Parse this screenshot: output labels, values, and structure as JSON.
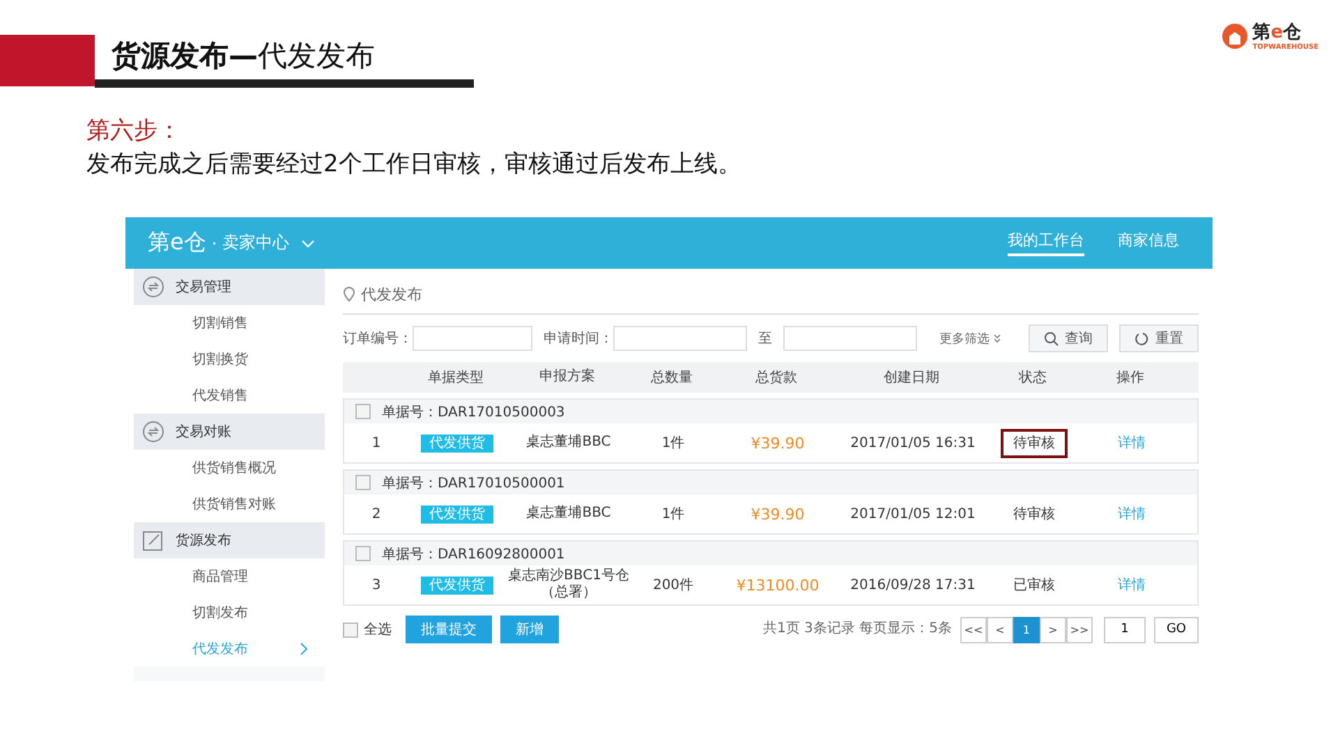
{
  "slide": {
    "title_bold": "货源发布—",
    "title_rest": "代发发布",
    "logo": {
      "mark": "第",
      "e": "e",
      "name": "仓",
      "sub": "TOPWAREHOUSE"
    },
    "step_label": "第六步：",
    "step_text": "发布完成之后需要经过2个工作日审核，审核通过后发布上线。"
  },
  "app": {
    "brand": "第e仓",
    "brand_sep": "·",
    "brand_sub": "卖家中心",
    "nav": [
      {
        "label": "我的工作台",
        "selected": true
      },
      {
        "label": "商家信息",
        "selected": false
      }
    ],
    "sidebar": [
      {
        "title": "交易管理",
        "kind": "cycle",
        "children": [
          {
            "label": "切割销售",
            "selected": false
          },
          {
            "label": "切割换货",
            "selected": false
          },
          {
            "label": "代发销售",
            "selected": false
          }
        ]
      },
      {
        "title": "交易对账",
        "kind": "cycle",
        "children": [
          {
            "label": "供货销售概况",
            "selected": false
          },
          {
            "label": "供货销售对账",
            "selected": false
          }
        ]
      },
      {
        "title": "货源发布",
        "kind": "edit",
        "children": [
          {
            "label": "商品管理",
            "selected": false
          },
          {
            "label": "切割发布",
            "selected": false
          },
          {
            "label": "代发发布",
            "selected": true
          }
        ]
      }
    ],
    "breadcrumb": "代发发布",
    "filters": {
      "order_label": "订单编号：",
      "date_label": "申请时间：",
      "to_label": "至",
      "more": "更多筛选",
      "search": "查询",
      "reset": "重置"
    },
    "columns": [
      "单据类型",
      "申报方案",
      "总数量",
      "总货款",
      "创建日期",
      "状态",
      "操作"
    ],
    "orders": [
      {
        "checked": false,
        "order_no": "单据号：DAR17010500003",
        "index": "1",
        "type": "代发供货",
        "plan": "桌志董埔BBC",
        "qty": "1件",
        "amount": "¥39.90",
        "date": "2017/01/05 16:31",
        "status": "待审核",
        "highlighted": true,
        "action": "详情"
      },
      {
        "checked": false,
        "order_no": "单据号：DAR17010500001",
        "index": "2",
        "type": "代发供货",
        "plan": "桌志董埔BBC",
        "qty": "1件",
        "amount": "¥39.90",
        "date": "2017/01/05 12:01",
        "status": "待审核",
        "highlighted": false,
        "action": "详情"
      },
      {
        "checked": false,
        "order_no": "单据号：DAR16092800001",
        "index": "3",
        "type": "代发供货",
        "plan": "桌志南沙BBC1号仓（总署）",
        "qty": "200件",
        "amount": "¥13100.00",
        "date": "2016/09/28 17:31",
        "status": "已审核",
        "highlighted": false,
        "action": "详情"
      }
    ],
    "footer": {
      "select_all_checked": false,
      "select_all": "全选",
      "batch": "批量提交",
      "add": "新增",
      "summary": "共1页 3条记录 每页显示：5条",
      "pages": [
        {
          "label": "<<",
          "selected": false
        },
        {
          "label": "<",
          "selected": false
        },
        {
          "label": "1",
          "selected": true
        },
        {
          "label": ">",
          "selected": false
        },
        {
          "label": ">>",
          "selected": false
        }
      ],
      "page_input": "1",
      "go": "GO"
    }
  }
}
